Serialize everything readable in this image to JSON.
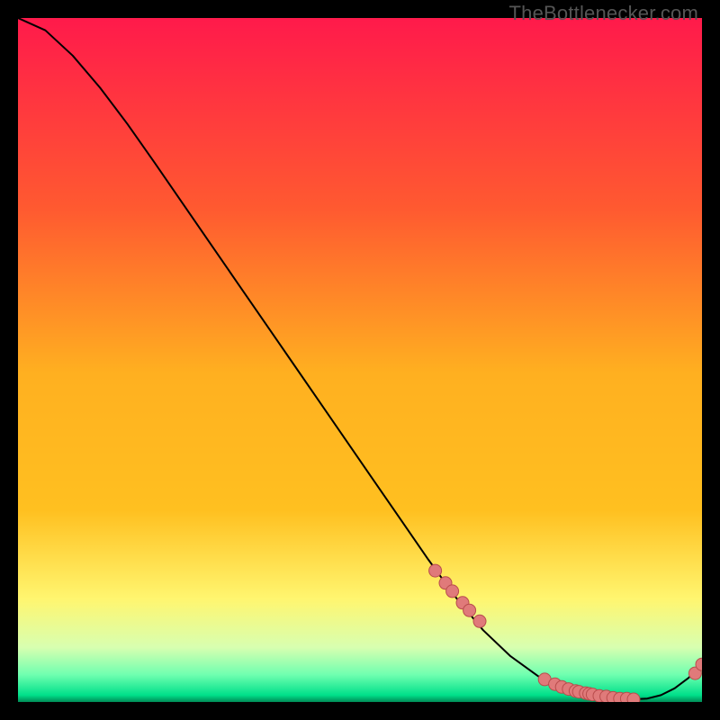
{
  "watermark": "TheBottlenecker.com",
  "colors": {
    "top": "#ff1a4b",
    "mid_top": "#ff6a2f",
    "mid": "#ffc020",
    "mid_bot": "#ffee40",
    "green_light": "#d4ffb0",
    "green_mid": "#6eff9e",
    "green": "#00e08a",
    "green_deep": "#009e5f",
    "curve": "#000000",
    "marker_fill": "#e07a7a",
    "marker_stroke": "#b94d4d"
  },
  "chart_data": {
    "type": "line",
    "title": "",
    "xlabel": "",
    "ylabel": "",
    "xlim": [
      0,
      100
    ],
    "ylim": [
      0,
      100
    ],
    "series": [
      {
        "name": "bottleneck-curve",
        "x": [
          0,
          4,
          8,
          12,
          16,
          20,
          24,
          28,
          32,
          36,
          40,
          44,
          48,
          52,
          56,
          60,
          64,
          68,
          72,
          76,
          78,
          80,
          82,
          84,
          86,
          88,
          90,
          92,
          94,
          96,
          98,
          100
        ],
        "y": [
          100,
          98.2,
          94.5,
          89.8,
          84.5,
          78.8,
          73.0,
          67.2,
          61.4,
          55.6,
          49.8,
          44.0,
          38.2,
          32.4,
          26.6,
          20.8,
          15.3,
          10.5,
          6.7,
          3.8,
          2.8,
          2.0,
          1.4,
          1.0,
          0.7,
          0.5,
          0.4,
          0.5,
          1.0,
          2.0,
          3.5,
          5.5
        ]
      }
    ],
    "markers": {
      "name": "highlighted-points",
      "x": [
        61,
        62.5,
        63.5,
        65,
        66,
        67.5,
        77,
        78.5,
        79.5,
        80.5,
        81.5,
        82,
        83,
        83.5,
        84,
        85,
        86,
        87,
        88,
        89,
        90,
        99,
        100
      ],
      "y": [
        19.2,
        17.4,
        16.2,
        14.5,
        13.4,
        11.8,
        3.3,
        2.6,
        2.2,
        1.9,
        1.6,
        1.5,
        1.3,
        1.2,
        1.1,
        0.9,
        0.8,
        0.6,
        0.5,
        0.5,
        0.4,
        4.2,
        5.5
      ]
    }
  }
}
